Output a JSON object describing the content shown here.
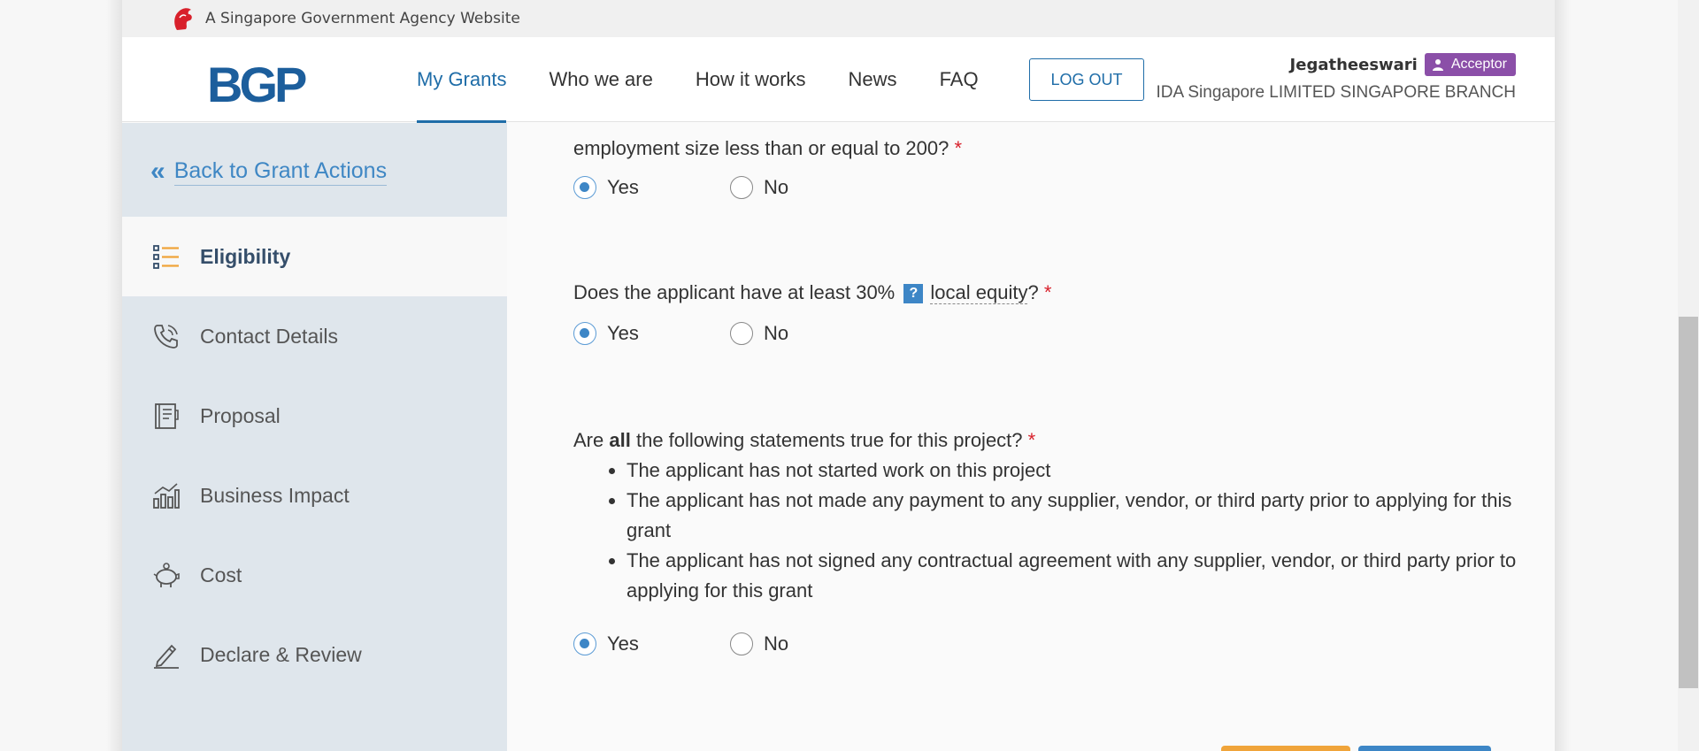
{
  "gov_banner": {
    "text": "A Singapore Government Agency Website"
  },
  "header": {
    "logo_text": "BGP",
    "nav": [
      {
        "label": "My Grants",
        "active": true
      },
      {
        "label": "Who we are",
        "active": false
      },
      {
        "label": "How it works",
        "active": false
      },
      {
        "label": "News",
        "active": false
      },
      {
        "label": "FAQ",
        "active": false
      }
    ],
    "logout_label": "LOG OUT",
    "user": {
      "name": "Jegatheeswari",
      "role": "Acceptor",
      "org": "IDA Singapore LIMITED SINGAPORE BRANCH"
    }
  },
  "sidebar": {
    "back_label": "Back to Grant Actions",
    "items": [
      {
        "label": "Eligibility",
        "icon": "list-icon",
        "active": true
      },
      {
        "label": "Contact Details",
        "icon": "phone-icon",
        "active": false
      },
      {
        "label": "Proposal",
        "icon": "document-icon",
        "active": false
      },
      {
        "label": "Business Impact",
        "icon": "bar-chart-icon",
        "active": false
      },
      {
        "label": "Cost",
        "icon": "piggy-bank-icon",
        "active": false
      },
      {
        "label": "Declare & Review",
        "icon": "pen-icon",
        "active": false
      }
    ]
  },
  "questions": {
    "q1": {
      "text": "employment size less than or equal to 200?",
      "required": "*",
      "yes": "Yes",
      "no": "No",
      "selected": "Yes"
    },
    "q2": {
      "text_before": "Does the applicant have at least 30%",
      "help": "?",
      "term": "local equity",
      "text_after": "?",
      "required": "*",
      "yes": "Yes",
      "no": "No",
      "selected": "Yes"
    },
    "q3": {
      "text_before": "Are",
      "emphasis": "all",
      "text_after": "the following statements true for this project?",
      "required": "*",
      "statements": [
        "The applicant has not started work on this project",
        "The applicant has not made any payment to any supplier, vendor, or third party prior to applying for this grant",
        "The applicant has not signed any contractual agreement with any supplier, vendor, or third party prior to applying for this grant"
      ],
      "yes": "Yes",
      "no": "No",
      "selected": "Yes"
    }
  },
  "colors": {
    "brand_blue": "#1f6da8",
    "role_purple": "#8b4fa8",
    "sidebar_bg": "#dfe6ec",
    "required_red": "#d8202b"
  }
}
